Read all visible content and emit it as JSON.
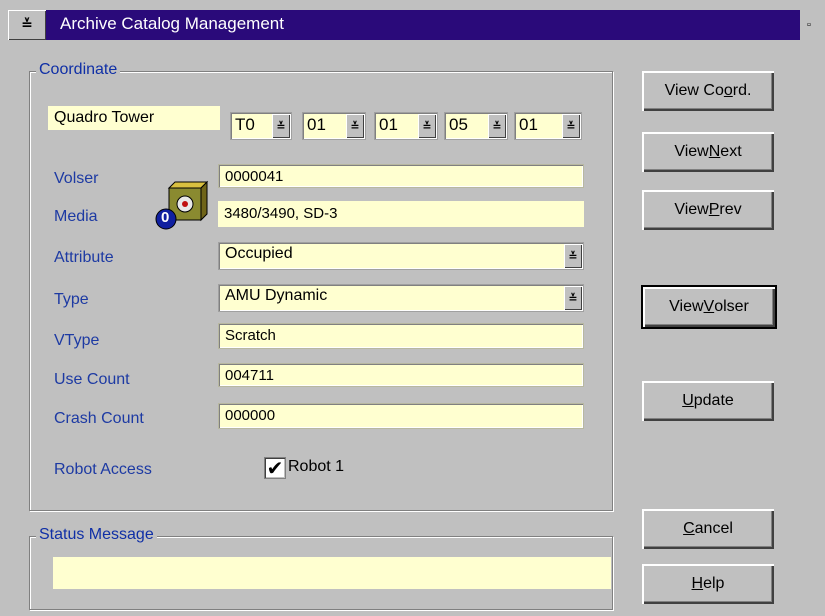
{
  "window": {
    "title": "Archive Catalog Management",
    "sysmenu_glyph": "≚",
    "restore_glyph": "▫"
  },
  "coordinate": {
    "group_label": "Coordinate",
    "tower_name": "Quadro Tower",
    "combos": [
      "T0",
      "01",
      "01",
      "05",
      "01"
    ],
    "fields": {
      "volser": {
        "label": "Volser",
        "value": "0000041"
      },
      "media": {
        "label": "Media",
        "value": "3480/3490, SD-3"
      },
      "attribute": {
        "label": "Attribute",
        "value": "Occupied"
      },
      "type": {
        "label": "Type",
        "value": "AMU Dynamic"
      },
      "vtype": {
        "label": "VType",
        "value": "Scratch"
      },
      "use_count": {
        "label": "Use Count",
        "value": "004711"
      },
      "crash_count": {
        "label": "Crash Count",
        "value": "000000"
      }
    },
    "media_badge": "0",
    "robot_access": {
      "label": "Robot Access",
      "checkbox_label": "Robot 1",
      "checked": true,
      "check_glyph": "✔"
    }
  },
  "status": {
    "group_label": "Status Message",
    "message": ""
  },
  "buttons": {
    "view_coord": {
      "pre": "View Co",
      "ul": "o",
      "post": "rd."
    },
    "view_next": {
      "pre": "View ",
      "ul": "N",
      "post": "ext"
    },
    "view_prev": {
      "pre": "View ",
      "ul": "P",
      "post": "rev"
    },
    "view_volser": {
      "pre": "View ",
      "ul": "V",
      "post": "olser"
    },
    "update": {
      "pre": "",
      "ul": "U",
      "post": "pdate"
    },
    "cancel": {
      "pre": "",
      "ul": "C",
      "post": "ancel"
    },
    "help": {
      "pre": "",
      "ul": "H",
      "post": "elp"
    }
  },
  "dropdown_glyph": "≚",
  "colors": {
    "title_bar": "#2a0a7a",
    "field_bg": "#ffffd0",
    "label": "#1d3aa3"
  }
}
